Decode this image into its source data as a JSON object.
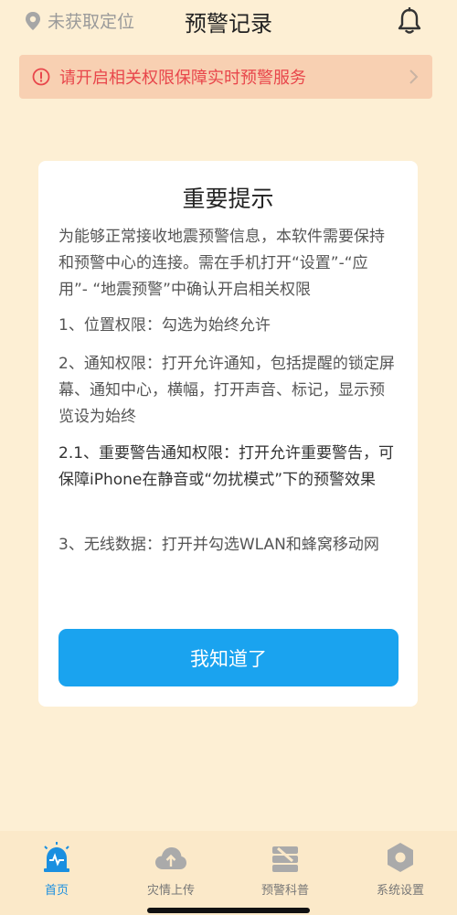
{
  "header": {
    "location_label": "未获取定位",
    "title": "预警记录"
  },
  "banner": {
    "text": "请开启相关权限保障实时预警服务"
  },
  "dialog": {
    "title": "重要提示",
    "paragraphs": [
      "为能够正常接收地震预警信息，本软件需要保持和预警中心的连接。需在手机打开“设置”-“应用”- “地震预警”中确认开启相关权限",
      "1、位置权限：勾选为始终允许",
      "2、通知权限：打开允许通知，包括提醒的锁定屏幕、通知中心，横幅，打开声音、标记，显示预览设为始终",
      "2.1、重要警告通知权限：打开允许重要警告，可保障iPhone在静音或“勿扰模式”下的预警效果",
      "3、无线数据：打开并勾选WLAN和蜂窝移动网"
    ],
    "button_label": "我知道了"
  },
  "tabs": [
    {
      "label": "首页",
      "icon": "alarm-icon",
      "active": true
    },
    {
      "label": "灾情上传",
      "icon": "cloud-upload-icon",
      "active": false
    },
    {
      "label": "预警科普",
      "icon": "book-icon",
      "active": false
    },
    {
      "label": "系统设置",
      "icon": "settings-hexagon-icon",
      "active": false
    }
  ],
  "colors": {
    "background": "#fdefd4",
    "accent": "#1aa3ef",
    "warning_text": "#e8464b",
    "banner_bg": "#f8d0b2"
  }
}
